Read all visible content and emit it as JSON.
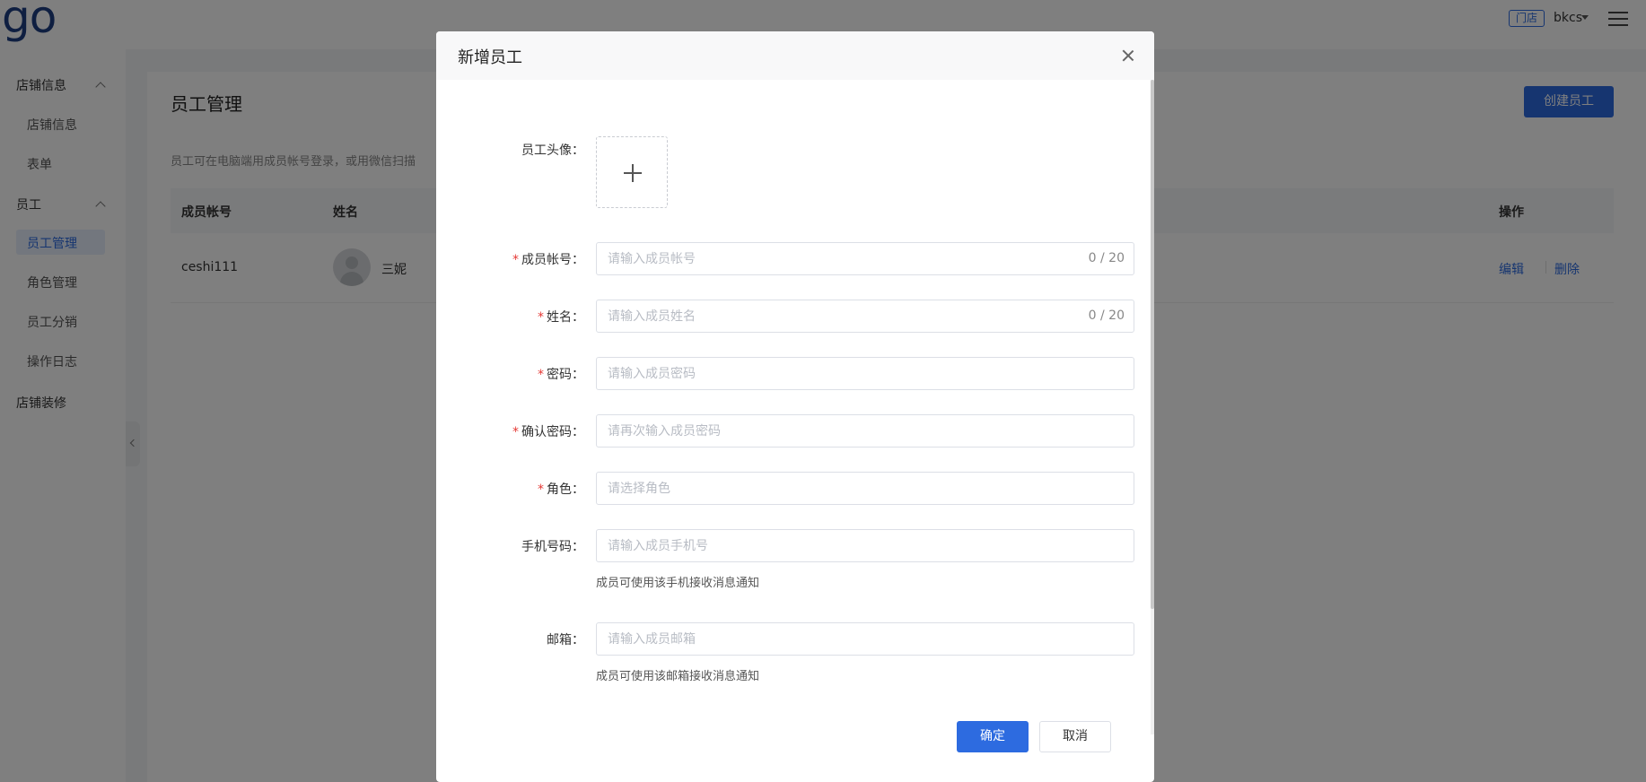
{
  "header": {
    "logo": "go",
    "store_badge": "门店",
    "user_name": "bkcs"
  },
  "sidebar": {
    "groups": [
      {
        "label": "店铺信息",
        "items": [
          "店铺信息",
          "表单"
        ]
      },
      {
        "label": "员工",
        "items": [
          "员工管理",
          "角色管理",
          "员工分销",
          "操作日志"
        ]
      },
      {
        "label": "店铺装修",
        "items": []
      }
    ],
    "active_item": "员工管理"
  },
  "main": {
    "title": "员工管理",
    "create_button": "创建员工",
    "description": "员工可在电脑端用成员帐号登录，或用微信扫描",
    "table": {
      "columns": [
        "成员帐号",
        "姓名",
        "操作"
      ],
      "rows": [
        {
          "account": "ceshi111",
          "name": "三妮",
          "actions": [
            "编辑",
            "删除"
          ]
        }
      ]
    }
  },
  "modal": {
    "title": "新增员工",
    "fields": {
      "avatar": {
        "label": "员工头像："
      },
      "account": {
        "label": "成员帐号：",
        "placeholder": "请输入成员帐号",
        "counter": "0 / 20",
        "required": true
      },
      "name": {
        "label": "姓名：",
        "placeholder": "请输入成员姓名",
        "counter": "0 / 20",
        "required": true
      },
      "password": {
        "label": "密码：",
        "placeholder": "请输入成员密码",
        "required": true
      },
      "confirm_password": {
        "label": "确认密码：",
        "placeholder": "请再次输入成员密码",
        "required": true
      },
      "role": {
        "label": "角色：",
        "placeholder": "请选择角色",
        "required": true
      },
      "phone": {
        "label": "手机号码：",
        "placeholder": "请输入成员手机号",
        "hint": "成员可使用该手机接收消息通知"
      },
      "email": {
        "label": "邮箱：",
        "placeholder": "请输入成员邮箱",
        "hint": "成员可使用该邮箱接收消息通知"
      }
    },
    "required_mark": "*",
    "ok_button": "确定",
    "cancel_button": "取消"
  },
  "colors": {
    "primary": "#2d6be0",
    "required": "#e53935",
    "brand": "#1f3f82"
  }
}
